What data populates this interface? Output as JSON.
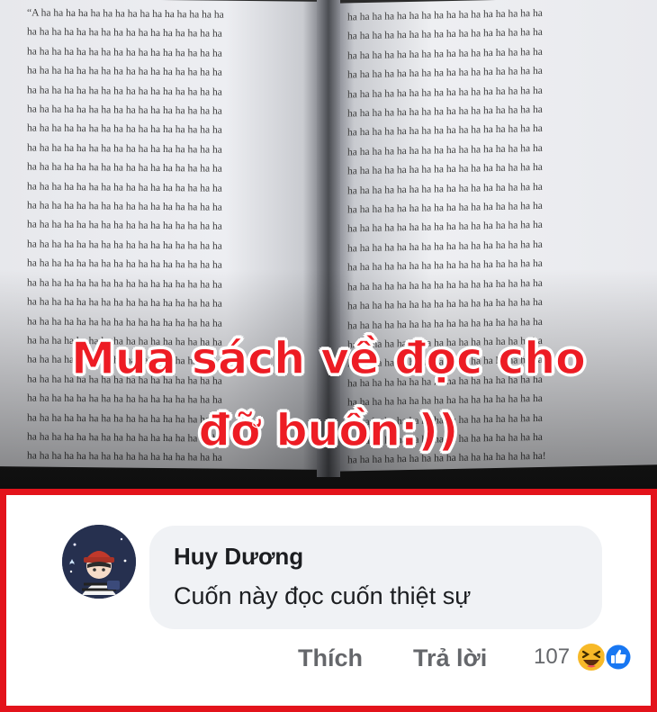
{
  "photo": {
    "page_text": "ha ha ha ha ha ha ha ha ha ha ha ha ha ha ha ha",
    "first_line": "“A ha ha ha ha ha ha ha ha ha ha ha ha ha ha ha",
    "last_line": "ha ha ha ha ha ha ha ha ha ha ha ha ha ha ha ha!"
  },
  "caption": {
    "line1": "Mua sách về đọc cho",
    "line2": "đỡ buồn:))",
    "color": "#ed1c24"
  },
  "comment": {
    "author": "Huy Dương",
    "text": "Cuốn này đọc cuốn thiệt sự",
    "actions": {
      "like": "Thích",
      "reply": "Trả lời"
    },
    "reaction_count": "107",
    "reactions": [
      "haha-icon",
      "like-icon"
    ]
  },
  "colors": {
    "frame": "#e3131b",
    "bubble": "#f0f2f5",
    "like_blue": "#1877f2",
    "haha_yellow": "#f7b928"
  }
}
